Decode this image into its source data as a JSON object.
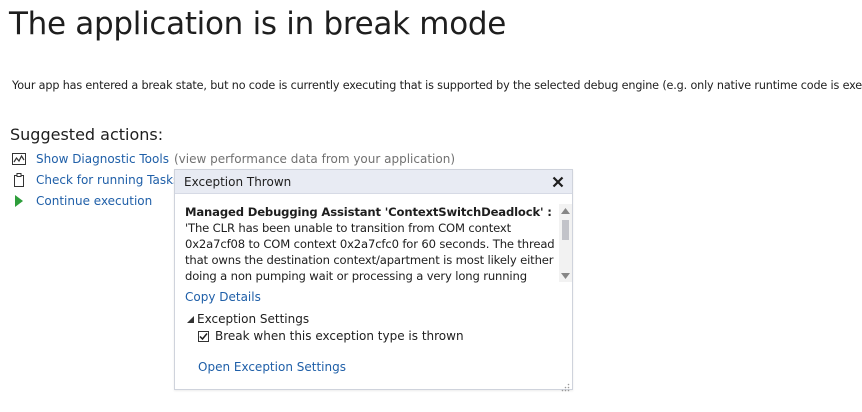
{
  "page": {
    "title": "The application is in break mode",
    "subtitle": "Your app has entered a break state, but no code is currently executing that is supported by the selected debug engine (e.g. only native runtime code is executing)."
  },
  "suggested": {
    "heading": "Suggested actions:",
    "actions": [
      {
        "label": "Show Diagnostic Tools",
        "note": "(view performance data from your application)",
        "icon": "diagnostic-tools-icon"
      },
      {
        "label": "Check for running Tasks",
        "icon": "clipboard-icon"
      },
      {
        "label": "Continue execution",
        "icon": "play-icon"
      }
    ]
  },
  "exception": {
    "title": "Exception Thrown",
    "message_bold": "Managed Debugging Assistant 'ContextSwitchDeadlock' :",
    "message_text": " 'The CLR has been unable to transition from COM context 0x2a7cf08 to COM context 0x2a7cfc0 for 60 seconds. The thread that owns the destination context/apartment is most likely either doing a non pumping wait or processing a very long running operation without",
    "copy_details": "Copy Details",
    "settings_heading": "Exception Settings",
    "break_label": "Break when this exception type is thrown",
    "break_checked": true,
    "open_settings": "Open Exception Settings"
  },
  "colors": {
    "link": "#1f5fa8",
    "play": "#2e9e3b",
    "header_bg": "#e8ebf3"
  }
}
